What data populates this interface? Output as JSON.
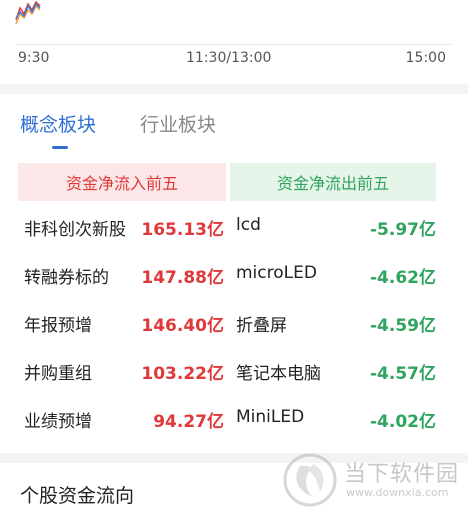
{
  "chart": {
    "line_colors": [
      "#e0393b",
      "#f0a13a",
      "#3b7bd9"
    ]
  },
  "time_axis": {
    "start": "9:30",
    "mid": "11:30/13:00",
    "end": "15:00"
  },
  "tabs": [
    {
      "label": "概念板块",
      "active": true
    },
    {
      "label": "行业板块",
      "active": false
    }
  ],
  "flow_headers": {
    "inflow": "资金净流入前五",
    "outflow": "资金净流出前五"
  },
  "rows": [
    {
      "in_name": "非科创次新股",
      "in_value": "165.13亿",
      "out_name": "lcd",
      "out_value": "-5.97亿"
    },
    {
      "in_name": "转融券标的",
      "in_value": "147.88亿",
      "out_name": "microLED",
      "out_value": "-4.62亿"
    },
    {
      "in_name": "年报预增",
      "in_value": "146.40亿",
      "out_name": "折叠屏",
      "out_value": "-4.59亿"
    },
    {
      "in_name": "并购重组",
      "in_value": "103.22亿",
      "out_name": "笔记本电脑",
      "out_value": "-4.57亿"
    },
    {
      "in_name": "业绩预增",
      "in_value": "94.27亿",
      "out_name": "MiniLED",
      "out_value": "-4.02亿"
    }
  ],
  "section": {
    "title": "个股资金流向"
  },
  "watermark": {
    "brand": "当下软件园",
    "url": "www.downxia.com"
  },
  "colors": {
    "accent": "#2f6fd6",
    "inflow": "#e0393b",
    "outflow": "#2ea45c"
  }
}
